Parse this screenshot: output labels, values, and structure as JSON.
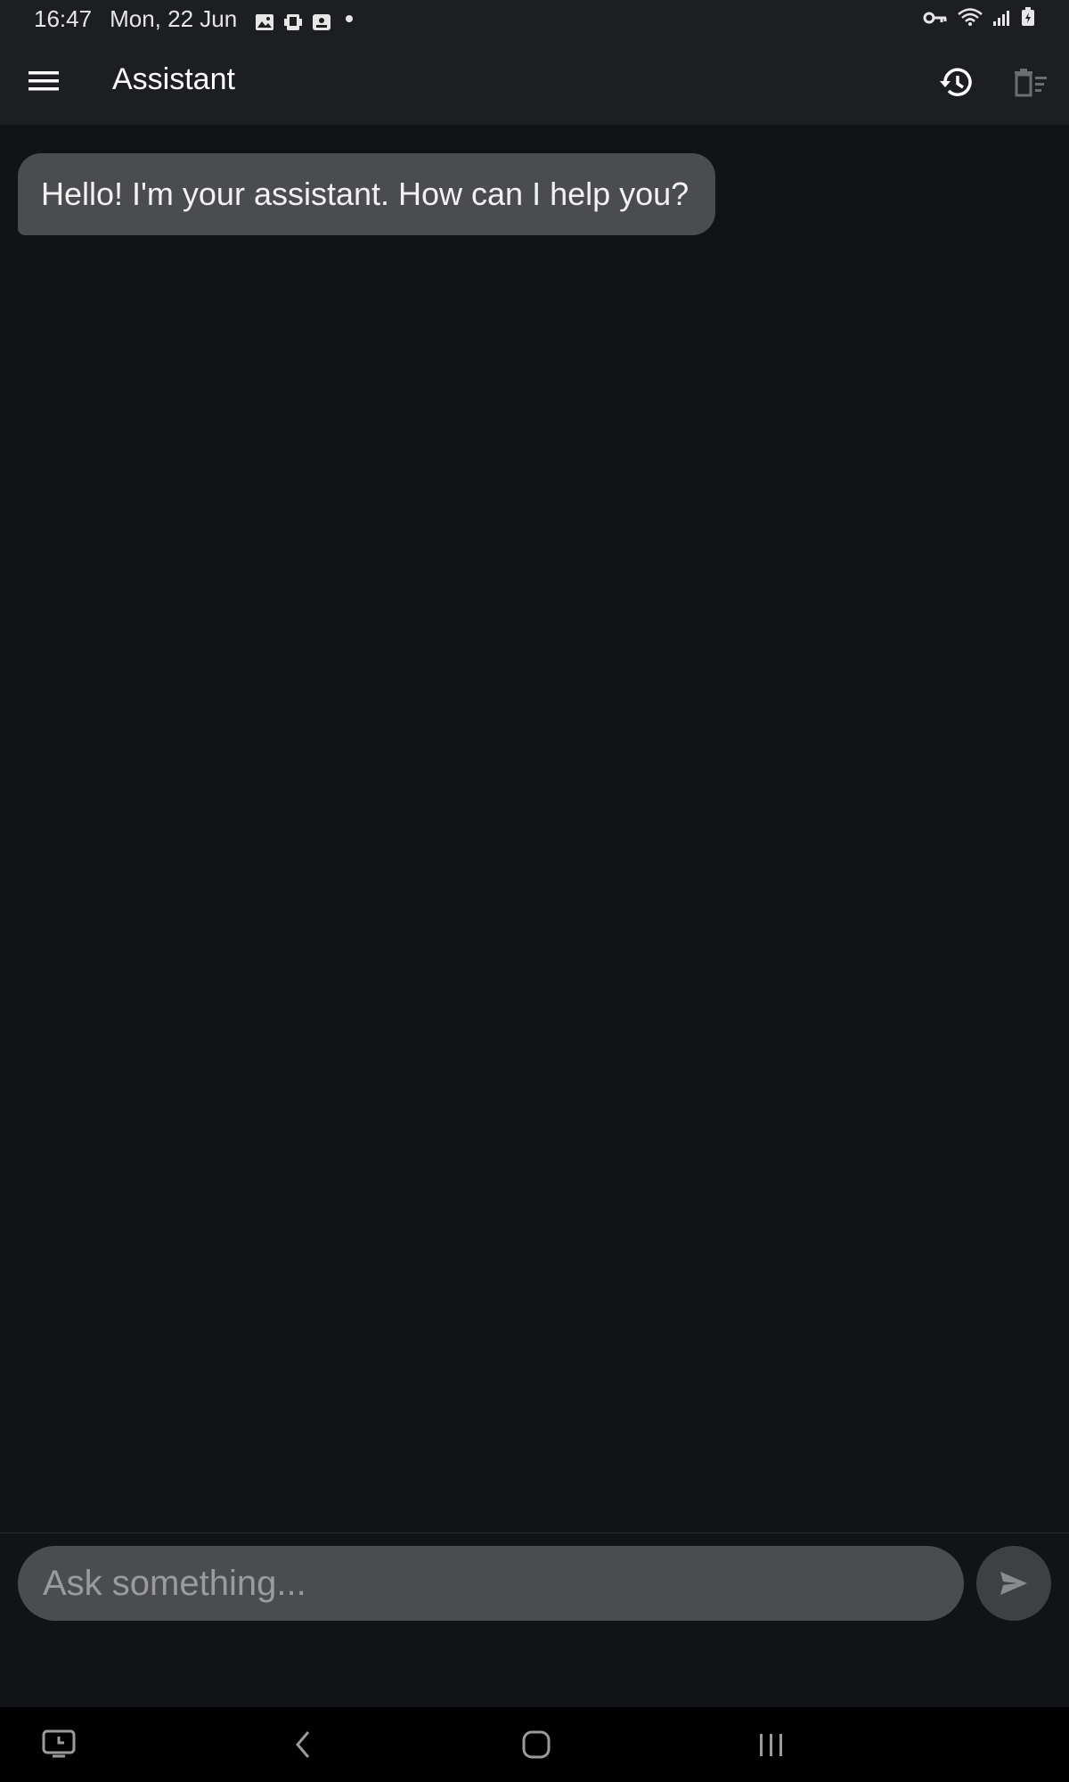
{
  "status_bar": {
    "time": "16:47",
    "date": "Mon, 22 Jun",
    "notification_icons": [
      "gallery-icon",
      "device-icon",
      "screenshot-icon"
    ],
    "system_icons": [
      "vpn-key-icon",
      "wifi-icon",
      "signal-icon",
      "battery-charging-icon"
    ]
  },
  "app_bar": {
    "title": "Assistant",
    "left_icon": "menu-icon",
    "right_icons": [
      "history-icon",
      "clear-chat-icon"
    ]
  },
  "chat": {
    "messages": [
      {
        "sender": "assistant",
        "text": "Hello! I'm your assistant. How can I help you?"
      }
    ]
  },
  "composer": {
    "placeholder": "Ask something...",
    "value": "",
    "send_icon": "send-icon"
  },
  "nav_bar": {
    "buttons": [
      "recent-apps-icon",
      "back-icon",
      "home-icon",
      "overview-icon"
    ]
  },
  "colors": {
    "background": "#121317",
    "app_bar": "#1c1e22",
    "bubble": "#4b4c4f",
    "input": "#4b4c4f",
    "send_button": "#3f4043",
    "progress_indicator": "#2b4a5c"
  }
}
